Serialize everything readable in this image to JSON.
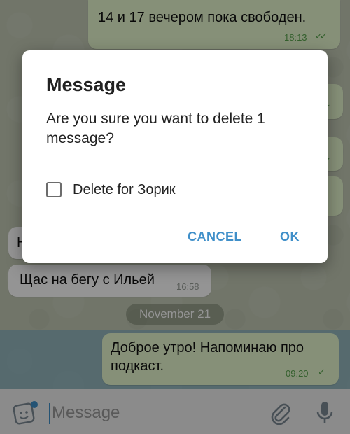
{
  "messages": [
    {
      "text": "14 и 17 вечером пока свободен.",
      "time": "18:13",
      "direction": "out"
    },
    {
      "text": "Щас на бегу с Ильей",
      "time": "16:58",
      "direction": "in"
    },
    {
      "text": "Доброе утро! Напоминаю про подкаст.",
      "line1": "Доброе утро! Напоминаю про",
      "line2": "подкаст.",
      "time": "09:20",
      "direction": "out"
    }
  ],
  "partial_marks": {
    "left_letter": "Н",
    "right_question": "?",
    "right_question2": "?"
  },
  "date_separator": "November 21",
  "dialog": {
    "title": "Message",
    "text": "Are you sure you want to delete 1 message?",
    "checkbox_label": "Delete for Зорик",
    "checkbox_checked": false,
    "cancel_label": "CANCEL",
    "ok_label": "OK"
  },
  "input": {
    "placeholder": "Message"
  },
  "icons": {
    "sticker": "sticker-icon",
    "attach": "paperclip-icon",
    "mic": "microphone-icon"
  },
  "colors": {
    "accent": "#3f8fc9",
    "outgoing_bubble": "#e7f9cf",
    "read_ticks": "#5aa54f"
  }
}
